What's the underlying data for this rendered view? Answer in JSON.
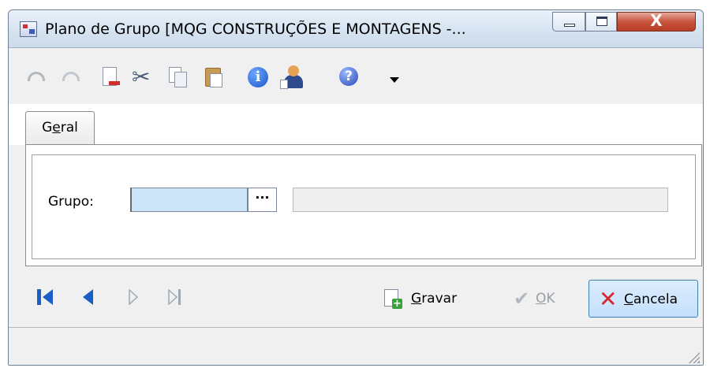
{
  "window": {
    "title": "Plano de Grupo [MQG CONSTRUÇÕES E MONTAGENS -...",
    "controls": {
      "close_glyph": "X"
    }
  },
  "toolbar": {
    "icons": [
      "undo-icon",
      "redo-icon",
      "delete-page-icon",
      "cut-icon",
      "copy-icon",
      "paste-icon",
      "info-icon",
      "user-icon",
      "help-icon",
      "dropdown-arrow-icon"
    ],
    "info_glyph": "i",
    "help_glyph": "?"
  },
  "tabs": [
    {
      "label_prefix": "G",
      "label_underlined": "e",
      "label_suffix": "ral",
      "selected": true
    }
  ],
  "form": {
    "grupo_label": "Grupo:",
    "grupo_value": "",
    "ellipsis_label": "···",
    "description_value": ""
  },
  "navigation": {
    "icons": [
      "first-record-icon",
      "previous-record-icon",
      "next-record-icon",
      "last-record-icon"
    ]
  },
  "actions": {
    "gravar": {
      "underlined": "G",
      "rest": "ravar",
      "enabled": true
    },
    "ok": {
      "underlined": "O",
      "rest": "K",
      "enabled": false
    },
    "cancela": {
      "underlined": "C",
      "rest": "ancela",
      "enabled": true,
      "focused": true
    }
  },
  "status": {
    "text": ""
  },
  "colors": {
    "accent": "#1a5fc8",
    "input_focus": "#cce4f7",
    "cancel_x": "#d8262e",
    "save_plus": "#39a03c"
  }
}
